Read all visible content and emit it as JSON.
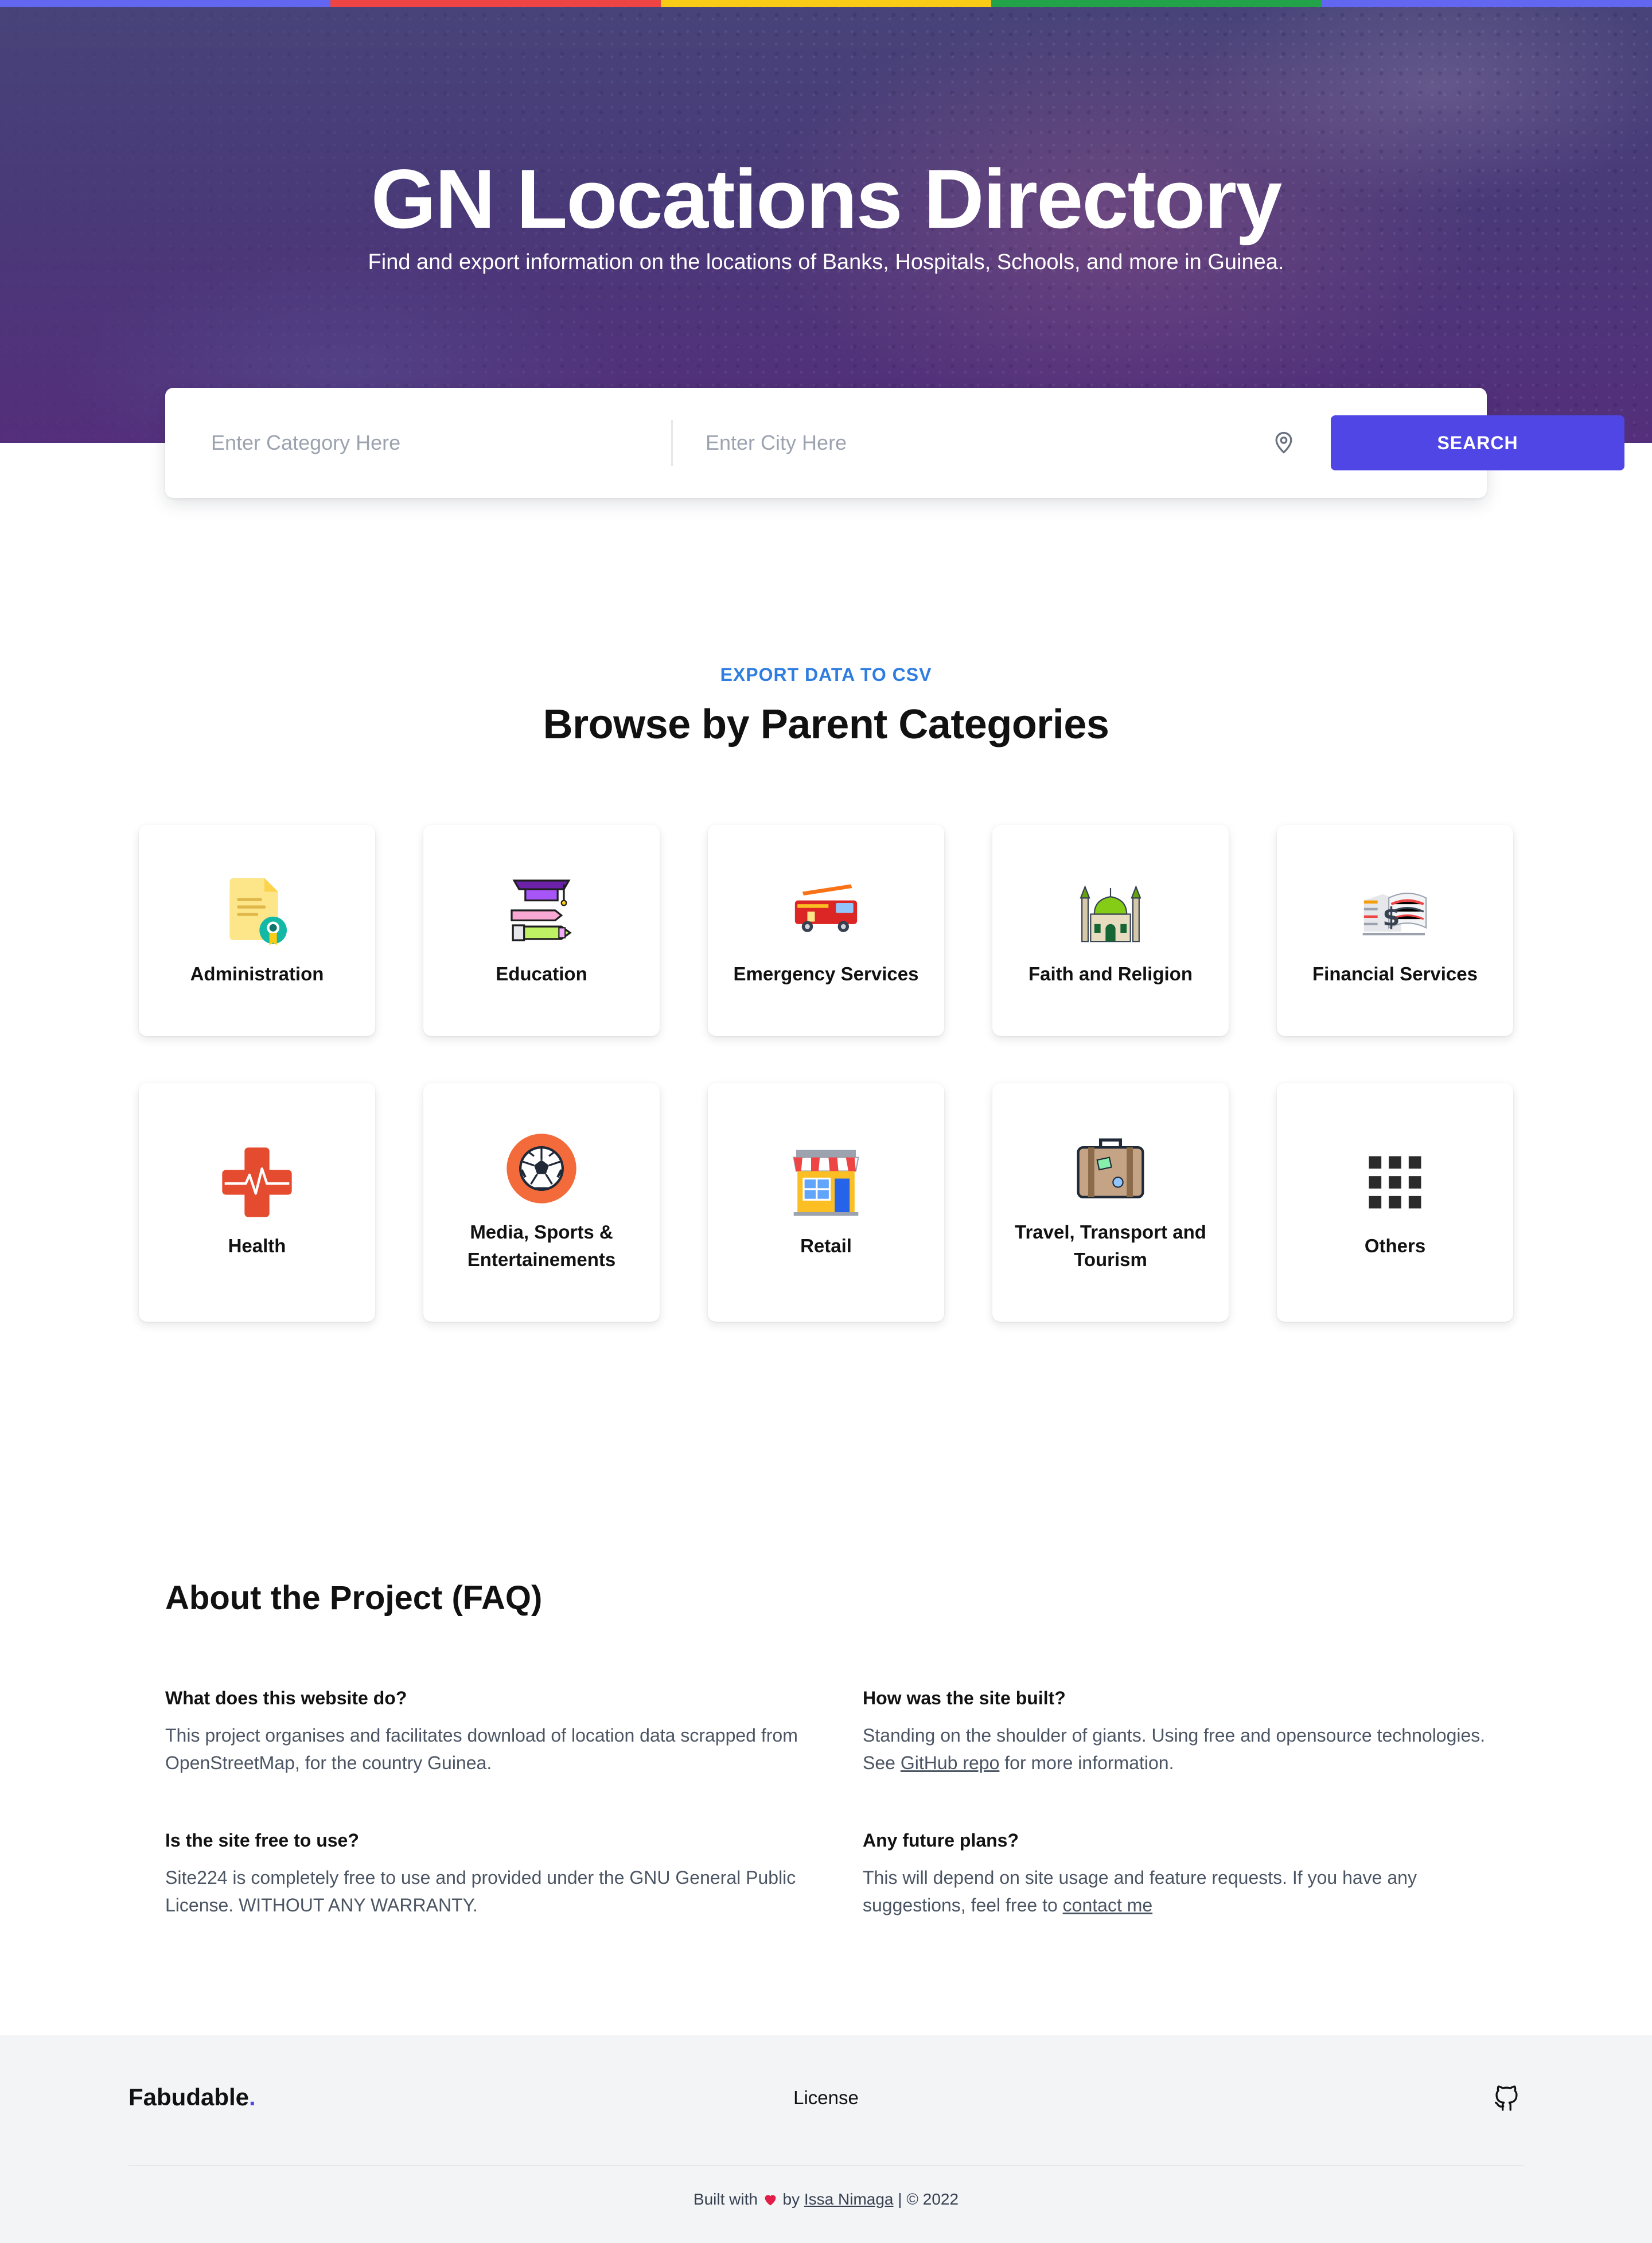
{
  "colors": {
    "stripe": [
      "#6366f1",
      "#ef4444",
      "#facc15",
      "#22a34a",
      "#6366f1"
    ],
    "accent": "#4f46e5",
    "eyebrow": "#2f7de0"
  },
  "hero": {
    "title": "GN Locations Directory",
    "subtitle": "Find and export information on the locations of Banks, Hospitals, Schools, and more in Guinea."
  },
  "search": {
    "category_placeholder": "Enter Category Here",
    "city_placeholder": "Enter City Here",
    "location_icon": "map-pin-icon",
    "button_label": "SEARCH"
  },
  "categories_section": {
    "eyebrow": "EXPORT DATA TO CSV",
    "title": "Browse by Parent Categories",
    "items": [
      {
        "label": "Administration",
        "icon": "document-badge-icon"
      },
      {
        "label": "Education",
        "icon": "graduation-cap-icon"
      },
      {
        "label": "Emergency Services",
        "icon": "fire-truck-icon"
      },
      {
        "label": "Faith and Religion",
        "icon": "mosque-icon"
      },
      {
        "label": "Financial Services",
        "icon": "banknotes-icon"
      },
      {
        "label": "Health",
        "icon": "medical-cross-icon"
      },
      {
        "label": "Media, Sports & Entertainements",
        "icon": "soccer-ball-icon"
      },
      {
        "label": "Retail",
        "icon": "storefront-icon"
      },
      {
        "label": "Travel, Transport and Tourism",
        "icon": "suitcase-icon"
      },
      {
        "label": "Others",
        "icon": "grid-dots-icon"
      }
    ]
  },
  "faq": {
    "title": "About the Project (FAQ)",
    "items": [
      {
        "question": "What does this website do?",
        "answer": "This project organises and facilitates download of location data scrapped from OpenStreetMap, for the country Guinea."
      },
      {
        "question": "How was the site built?",
        "answer_before": "Standing on the shoulder of giants. Using free and opensource technologies. See ",
        "link": "GitHub repo",
        "answer_after": " for more information."
      },
      {
        "question": "Is the site free to use?",
        "answer": "Site224 is completely free to use and provided under the GNU General Public License. WITHOUT ANY WARRANTY."
      },
      {
        "question": "Any future plans?",
        "answer_before": "This will depend on site usage and feature requests. If you have any suggestions, feel free to ",
        "link": "contact me",
        "answer_after": ""
      }
    ]
  },
  "footer": {
    "brand": "Fabudable",
    "brand_dot": ".",
    "license": "License",
    "github_icon": "github-icon",
    "credit_before": "Built with",
    "heart_icon": "heart-icon",
    "credit_by": "by",
    "author": "Issa Nimaga",
    "credit_after": "| © 2022"
  }
}
